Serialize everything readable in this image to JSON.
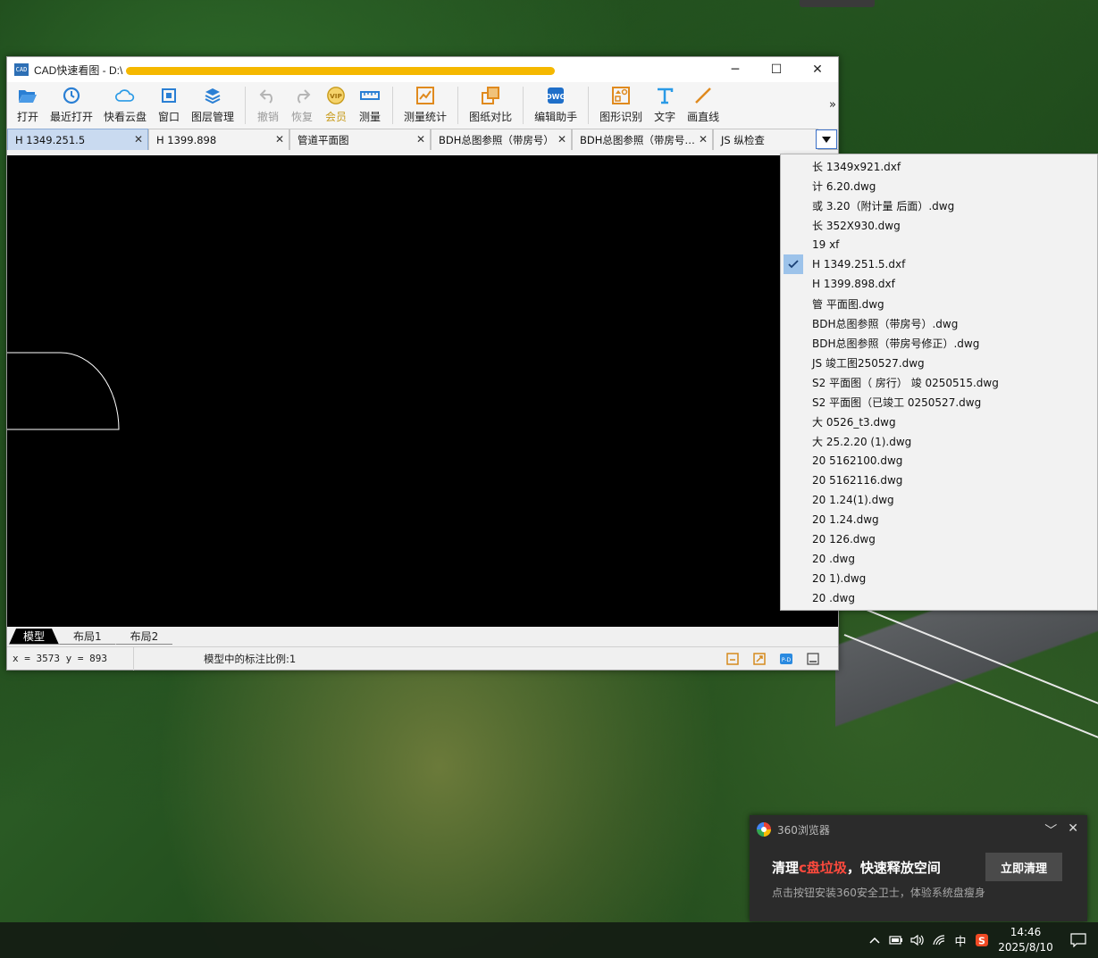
{
  "window": {
    "title_prefix": "CAD快速看图 - D:\\",
    "icon_text": "CAD",
    "controls": [
      "─",
      "☐",
      "✕"
    ]
  },
  "toolbar": {
    "items": [
      {
        "label": "打开",
        "icon": "folder-open-icon",
        "enabled": true
      },
      {
        "label": "最近打开",
        "icon": "clock-history-icon",
        "enabled": true
      },
      {
        "label": "快看云盘",
        "icon": "cloud-icon",
        "enabled": true
      },
      {
        "label": "窗口",
        "icon": "window-icon",
        "enabled": true
      },
      {
        "label": "图层管理",
        "icon": "layers-icon",
        "enabled": true
      },
      {
        "label": "撤销",
        "icon": "undo-icon",
        "enabled": false
      },
      {
        "label": "恢复",
        "icon": "redo-icon",
        "enabled": false
      },
      {
        "label": "会员",
        "icon": "vip-icon",
        "enabled": true
      },
      {
        "label": "测量",
        "icon": "ruler-icon",
        "enabled": true
      },
      {
        "label": "测量统计",
        "icon": "measure-stats-icon",
        "enabled": true
      },
      {
        "label": "图纸对比",
        "icon": "compare-icon",
        "enabled": true
      },
      {
        "label": "编辑助手",
        "icon": "edit-assistant-icon",
        "enabled": true
      },
      {
        "label": "图形识别",
        "icon": "shape-recognition-icon",
        "enabled": true
      },
      {
        "label": "文字",
        "icon": "text-icon",
        "enabled": true
      },
      {
        "label": "画直线",
        "icon": "line-icon",
        "enabled": true
      }
    ],
    "more": "»"
  },
  "tabs": [
    {
      "label": "H 1349.251.5",
      "active": true
    },
    {
      "label": "H 1399.898",
      "active": false
    },
    {
      "label": "管道平面图",
      "active": false
    },
    {
      "label": "BDH总图参照（带房号）",
      "active": false
    },
    {
      "label": "BDH总图参照（带房号…",
      "active": false
    },
    {
      "label": "JS 纵检查",
      "active": false
    }
  ],
  "layout_tabs": [
    "模型",
    "布局1",
    "布局2"
  ],
  "status": {
    "coords": "x = 3573 y = 893",
    "scale": "模型中的标注比例:1"
  },
  "file_list": [
    {
      "name": "长 1349x921.dxf",
      "checked": false
    },
    {
      "name": "计 6.20.dwg",
      "checked": false
    },
    {
      "name": "或 3.20（附计量 后面）.dwg",
      "checked": false
    },
    {
      "name": "长 352X930.dwg",
      "checked": false
    },
    {
      "name": "19 xf",
      "checked": false
    },
    {
      "name": "H 1349.251.5.dxf",
      "checked": true
    },
    {
      "name": "H 1399.898.dxf",
      "checked": false
    },
    {
      "name": "管 平面图.dwg",
      "checked": false
    },
    {
      "name": "BDH总图参照（带房号）.dwg",
      "checked": false
    },
    {
      "name": "BDH总图参照（带房号修正）.dwg",
      "checked": false
    },
    {
      "name": "JS 竣工图250527.dwg",
      "checked": false
    },
    {
      "name": "S2 平面图（ 房行） 竣 0250515.dwg",
      "checked": false
    },
    {
      "name": "S2 平面图（已竣工 0250527.dwg",
      "checked": false
    },
    {
      "name": "大 0526_t3.dwg",
      "checked": false
    },
    {
      "name": "大 25.2.20 (1).dwg",
      "checked": false
    },
    {
      "name": "20 5162100.dwg",
      "checked": false
    },
    {
      "name": "20 5162116.dwg",
      "checked": false
    },
    {
      "name": "20 1.24(1).dwg",
      "checked": false
    },
    {
      "name": "20 1.24.dwg",
      "checked": false
    },
    {
      "name": "20 126.dwg",
      "checked": false
    },
    {
      "name": "20 .dwg",
      "checked": false
    },
    {
      "name": "20 1).dwg",
      "checked": false
    },
    {
      "name": "20 .dwg",
      "checked": false
    }
  ],
  "toast": {
    "app": "360浏览器",
    "title_before": "清理",
    "title_highlight": "c盘垃圾",
    "title_after": "，快速释放空间",
    "body": "点击按钮安装360安全卫士，体验系统盘瘦身",
    "button": "立即清理"
  },
  "taskbar": {
    "ime": "中",
    "time": "14:46",
    "date": "2025/8/10"
  },
  "colors": {
    "accent": "#3a6fc7",
    "active_tab": "#c9daf0",
    "highlight": "#ff4a3d",
    "redaction": "#f5b800"
  }
}
